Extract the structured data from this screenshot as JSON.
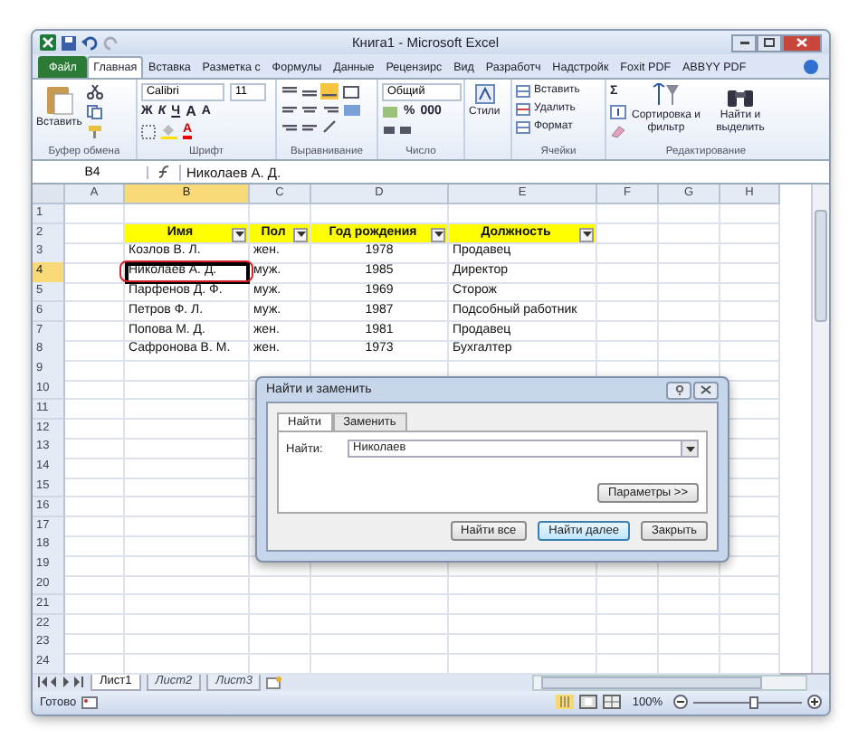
{
  "window": {
    "title": "Книга1 - Microsoft Excel"
  },
  "ribbon_tabs": [
    {
      "label": "Файл",
      "kind": "file",
      "selected": false
    },
    {
      "label": "Главная",
      "kind": "tab",
      "selected": true
    },
    {
      "label": "Вставка",
      "kind": "tab",
      "selected": false
    },
    {
      "label": "Разметка с",
      "kind": "tab",
      "selected": false
    },
    {
      "label": "Формулы",
      "kind": "tab",
      "selected": false
    },
    {
      "label": "Данные",
      "kind": "tab",
      "selected": false
    },
    {
      "label": "Рецензирс",
      "kind": "tab",
      "selected": false
    },
    {
      "label": "Вид",
      "kind": "tab",
      "selected": false
    },
    {
      "label": "Разработч",
      "kind": "tab",
      "selected": false
    },
    {
      "label": "Надстройк",
      "kind": "tab",
      "selected": false
    },
    {
      "label": "Foxit PDF",
      "kind": "tab",
      "selected": false
    },
    {
      "label": "ABBYY PDF",
      "kind": "tab",
      "selected": false
    }
  ],
  "ribbon": {
    "clipboard": {
      "paste": "Вставить",
      "label": "Буфер обмена"
    },
    "font": {
      "name": "Calibri",
      "size": "11",
      "styles": [
        "Ж",
        "К",
        "Ч"
      ],
      "grow": "A",
      "shrink": "A",
      "font_color_button": "A",
      "label": "Шрифт"
    },
    "alignment": {
      "label": "Выравнивание"
    },
    "number": {
      "format": "Общий",
      "buttons": [
        "%",
        "000"
      ],
      "label": "Число"
    },
    "styles": {
      "button": "Стили"
    },
    "cells": {
      "items": [
        "Вставить",
        "Удалить",
        "Формат"
      ],
      "label": "Ячейки"
    },
    "editing": {
      "sum": "Σ",
      "items": [
        "Сортировка и фильтр",
        "Найти и выделить"
      ],
      "label": "Редактирование"
    }
  },
  "formula_bar": {
    "name_box": "B4",
    "value": "Николаев А. Д."
  },
  "columns": [
    {
      "label": "A",
      "selected": false
    },
    {
      "label": "B",
      "selected": true
    },
    {
      "label": "C",
      "selected": false
    },
    {
      "label": "D",
      "selected": false
    },
    {
      "label": "E",
      "selected": false
    },
    {
      "label": "F",
      "selected": false
    },
    {
      "label": "G",
      "selected": false
    },
    {
      "label": "H",
      "selected": false
    }
  ],
  "rows": [
    {
      "number": "1",
      "selected": false
    },
    {
      "number": "2",
      "selected": false
    },
    {
      "number": "3",
      "selected": false
    },
    {
      "number": "4",
      "selected": true
    },
    {
      "number": "5",
      "selected": false
    },
    {
      "number": "6",
      "selected": false
    },
    {
      "number": "7",
      "selected": false
    },
    {
      "number": "8",
      "selected": false
    },
    {
      "number": "9",
      "selected": false
    },
    {
      "number": "10",
      "selected": false
    },
    {
      "number": "11",
      "selected": false
    },
    {
      "number": "12",
      "selected": false
    },
    {
      "number": "13",
      "selected": false
    },
    {
      "number": "14",
      "selected": false
    },
    {
      "number": "15",
      "selected": false
    },
    {
      "number": "16",
      "selected": false
    },
    {
      "number": "17",
      "selected": false
    },
    {
      "number": "18",
      "selected": false
    },
    {
      "number": "19",
      "selected": false
    },
    {
      "number": "20",
      "selected": false
    },
    {
      "number": "21",
      "selected": false
    },
    {
      "number": "22",
      "selected": false
    },
    {
      "number": "23",
      "selected": false
    },
    {
      "number": "24",
      "selected": false
    }
  ],
  "table": {
    "header": [
      "Имя",
      "Пол",
      "Год рождения",
      "Должность"
    ],
    "rows": [
      {
        "cells": [
          {
            "text": "Козлов В. Л.",
            "active": false,
            "circled": false
          },
          {
            "text": "жен.",
            "active": false,
            "circled": false
          },
          {
            "text": "1978",
            "active": false,
            "circled": false
          },
          {
            "text": "Продавец",
            "active": false,
            "circled": false
          }
        ]
      },
      {
        "cells": [
          {
            "text": "Николаев А. Д.",
            "active": true,
            "circled": true
          },
          {
            "text": "муж.",
            "active": false,
            "circled": false
          },
          {
            "text": "1985",
            "active": false,
            "circled": false
          },
          {
            "text": "Директор",
            "active": false,
            "circled": false
          }
        ]
      },
      {
        "cells": [
          {
            "text": "Парфенов Д. Ф.",
            "active": false,
            "circled": false
          },
          {
            "text": "муж.",
            "active": false,
            "circled": false
          },
          {
            "text": "1969",
            "active": false,
            "circled": false
          },
          {
            "text": "Сторож",
            "active": false,
            "circled": false
          }
        ]
      },
      {
        "cells": [
          {
            "text": "Петров Ф. Л.",
            "active": false,
            "circled": false
          },
          {
            "text": "муж.",
            "active": false,
            "circled": false
          },
          {
            "text": "1987",
            "active": false,
            "circled": false
          },
          {
            "text": "Подсобный работник",
            "active": false,
            "circled": false
          }
        ]
      },
      {
        "cells": [
          {
            "text": "Попова М. Д.",
            "active": false,
            "circled": false
          },
          {
            "text": "жен.",
            "active": false,
            "circled": false
          },
          {
            "text": "1981",
            "active": false,
            "circled": false
          },
          {
            "text": "Продавец",
            "active": false,
            "circled": false
          }
        ]
      },
      {
        "cells": [
          {
            "text": "Сафронова В. М.",
            "active": false,
            "circled": false
          },
          {
            "text": "жен.",
            "active": false,
            "circled": false
          },
          {
            "text": "1973",
            "active": false,
            "circled": false
          },
          {
            "text": "Бухгалтер",
            "active": false,
            "circled": false
          }
        ]
      }
    ]
  },
  "sheet_tabs": [
    {
      "label": "Лист1",
      "selected": true
    },
    {
      "label": "Лист2",
      "selected": false
    },
    {
      "label": "Лист3",
      "selected": false
    }
  ],
  "status_bar": {
    "status": "Готово",
    "zoom": "100%",
    "zoom_level": {
      "level": 0.55
    }
  },
  "dialog": {
    "title": "Найти и заменить",
    "tabs": [
      {
        "label": "Найти",
        "selected": true
      },
      {
        "label": "Заменить",
        "selected": false
      }
    ],
    "find_label": "Найти:",
    "find_value": "Николаев",
    "options_button": "Параметры >>",
    "buttons": [
      {
        "label": "Найти все",
        "default": false
      },
      {
        "label": "Найти далее",
        "default": true
      },
      {
        "label": "Закрыть",
        "default": false
      }
    ]
  }
}
